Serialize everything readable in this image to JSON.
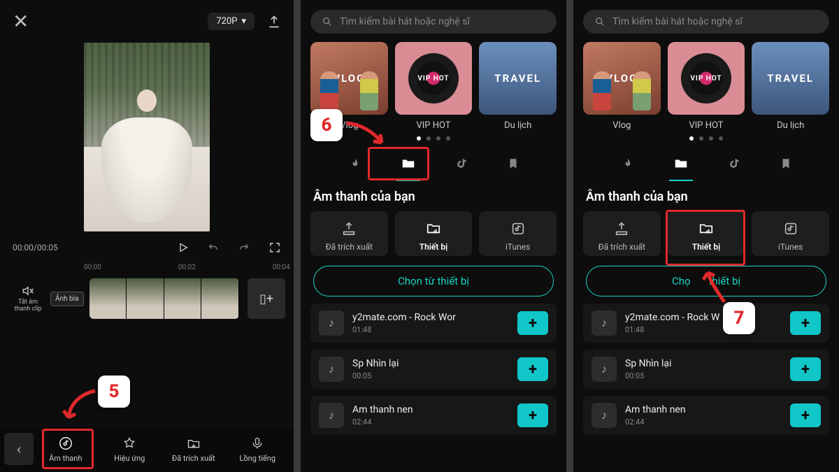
{
  "accent": "#19d4c6",
  "hl_color": "#e1292b",
  "editor": {
    "resolution": "720P",
    "time_current": "00:00",
    "time_total": "00:05",
    "ruler": [
      "00:00",
      "00:02",
      "00:04"
    ],
    "mute_label": "Tắt âm thanh clip",
    "cover_label": "Ảnh bìa",
    "tools": {
      "back": "‹",
      "audio": "Âm thanh",
      "effects": "Hiệu ứng",
      "extracted": "Đã trích xuất",
      "voiceover": "Lồng tiếng"
    }
  },
  "search": {
    "placeholder": "Tìm kiếm bài hát hoặc nghệ sĩ"
  },
  "categories": {
    "vlog": {
      "card": "VLOG",
      "label": "Vlog"
    },
    "vip": {
      "card": "VIP HOT",
      "label": "VIP HOT"
    },
    "travel": {
      "card": "TRAVEL",
      "label": "Du lịch"
    }
  },
  "section_title": "Âm thanh của bạn",
  "sources": {
    "extracted": "Đã trích xuất",
    "device": "Thiết bị",
    "itunes": "iTunes"
  },
  "select_button": "Chọn từ thiết bị",
  "songs": [
    {
      "title": "y2mate.com - Rock Wor",
      "duration": "01:48"
    },
    {
      "title": "Sp Nhìn lại",
      "duration": "00:05"
    },
    {
      "title": "Am thanh nen",
      "duration": "02:44"
    }
  ],
  "songs_right": [
    {
      "title": "y2mate.com - Rock W",
      "duration": "01:48"
    },
    {
      "title": "Sp Nhìn lại",
      "duration": "00:05"
    },
    {
      "title": "Am thanh nen",
      "duration": "02:44"
    }
  ],
  "steps": {
    "five": "5",
    "six": "6",
    "seven": "7"
  },
  "panel_right_select_prefix": "Chọ",
  "panel_right_select_suffix": "thiết bị"
}
